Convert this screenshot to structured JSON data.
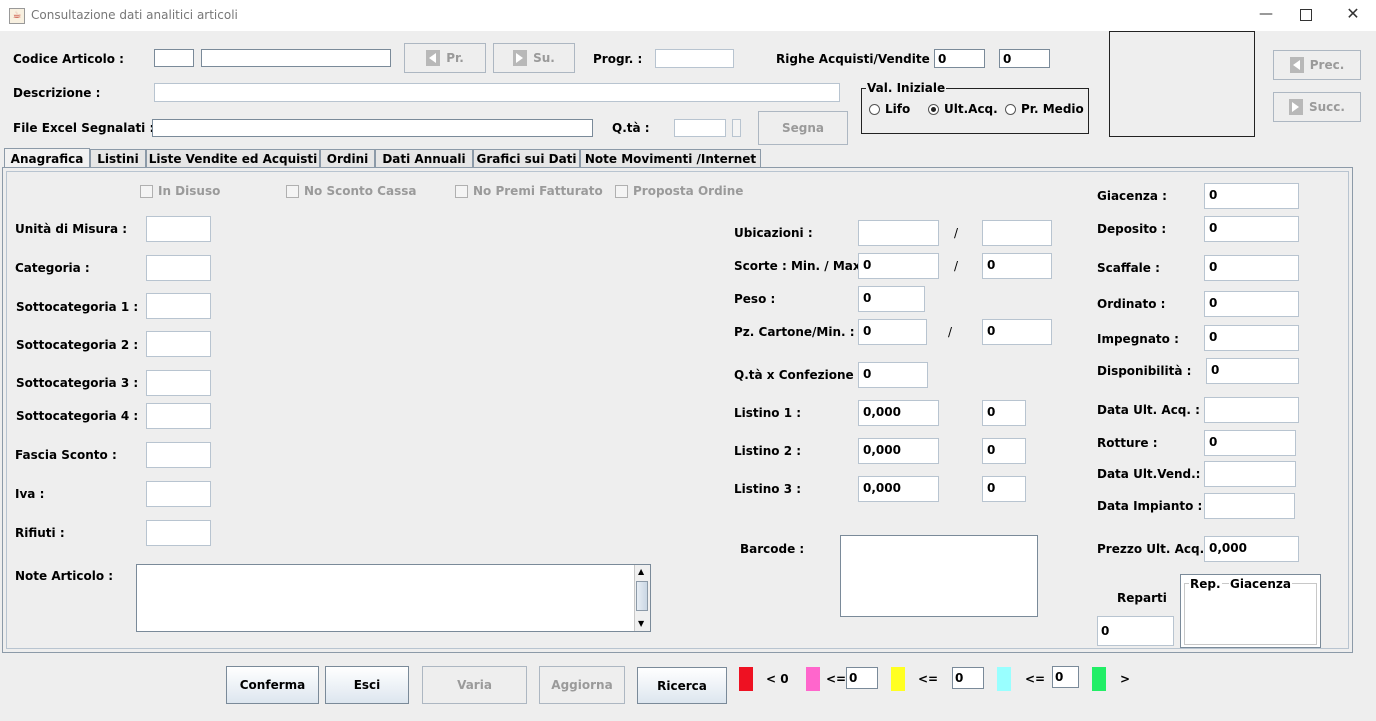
{
  "window": {
    "title": "Consultazione dati analitici articoli"
  },
  "header": {
    "codice_label": "Codice Articolo :",
    "codice_value": "",
    "codice_desc_value": "",
    "pr_label": "Pr.",
    "su_label": "Su.",
    "progr_label": "Progr. :",
    "progr_value": "",
    "righe_label": "Righe Acquisti/Vendite :",
    "righe_acquisti": "0",
    "righe_vendite": "0",
    "descrizione_label": "Descrizione :",
    "descrizione_value": "",
    "file_excel_label": "File Excel Segnalati :",
    "file_excel_value": "",
    "qta_label": "Q.tà :",
    "qta_value": "",
    "segna_label": "Segna",
    "prec_label": "Prec.",
    "succ_label": "Succ.",
    "val_iniziale": {
      "title": "Val. Iniziale",
      "options": [
        "Lifo",
        "Ult.Acq.",
        "Pr. Medio"
      ],
      "selected": "Ult.Acq."
    }
  },
  "tabs": [
    "Anagrafica",
    "Listini",
    "Liste Vendite ed Acquisti",
    "Ordini",
    "Dati Annuali",
    "Grafici sui Dati",
    "Note Movimenti /Internet"
  ],
  "active_tab": "Anagrafica",
  "checkboxes": [
    "In Disuso",
    "No Sconto Cassa",
    "No Premi Fatturato",
    "Proposta Ordine"
  ],
  "left": {
    "unita": "Unità di Misura :",
    "categoria": "Categoria :",
    "sottocat1": "Sottocategoria  1 :",
    "sottocat2": "Sottocategoria  2 :",
    "sottocat3": "Sottocategoria  3 :",
    "sottocat4": "Sottocategoria  4 :",
    "fascia": "Fascia Sconto :",
    "iva": "Iva :",
    "rifiuti": "Rifiuti :",
    "note": "Note Articolo :"
  },
  "middle": {
    "ubicazioni_label": "Ubicazioni :",
    "ubicazioni_1": "",
    "ubicazioni_2": "",
    "slash": "/",
    "scorte_label": "Scorte : Min. / Max. :",
    "scorte_min": "0",
    "scorte_max": "0",
    "peso_label": "Peso :",
    "peso": "0",
    "pz_label": "Pz. Cartone/Min. :",
    "pz_cartone": "0",
    "pz_min": "0",
    "qta_conf_label": "Q.tà x Confezione :",
    "qta_conf": "0",
    "listino1_label": "Listino 1 :",
    "listino1": "0,000",
    "listino1_b": "0",
    "listino2_label": "Listino 2 :",
    "listino2": "0,000",
    "listino2_b": "0",
    "listino3_label": "Listino 3 :",
    "listino3": "0,000",
    "listino3_b": "0",
    "barcode_label": "Barcode :"
  },
  "right": {
    "giacenza_label": "Giacenza :",
    "giacenza": "0",
    "deposito_label": "Deposito :",
    "deposito": "0",
    "scaffale_label": "Scaffale :",
    "scaffale": "0",
    "ordinato_label": "Ordinato :",
    "ordinato": "0",
    "impegnato_label": "Impegnato :",
    "impegnato": "0",
    "disponibilita_label": "Disponibilità :",
    "disponibilita": "0",
    "data_ult_acq_label": "Data Ult. Acq. :",
    "data_ult_acq": "",
    "rotture_label": "Rotture :",
    "rotture": "0",
    "data_ult_vend_label": "Data Ult.Vend.:",
    "data_ult_vend": "",
    "data_impianto_label": "Data Impianto :",
    "data_impianto": "",
    "prezzo_label": "Prezzo Ult. Acq. :",
    "prezzo": "0,000",
    "reparti_label": "Reparti",
    "reparti": "0",
    "rep_col": "Rep.",
    "giacenza_col": "Giacenza"
  },
  "footer": {
    "conferma": "Conferma",
    "esci": "Esci",
    "varia": "Varia",
    "aggiorna": "Aggiorna",
    "ricerca": "Ricerca",
    "lt0": "< 0",
    "le1": "<=",
    "v1": "0",
    "le2": "<=",
    "v2": "0",
    "le3": "<=",
    "v3": "0",
    "gt": ">",
    "colors": [
      "#ee1122",
      "#ff66cc",
      "#ffff22",
      "#99ffff",
      "#22ee66"
    ]
  }
}
